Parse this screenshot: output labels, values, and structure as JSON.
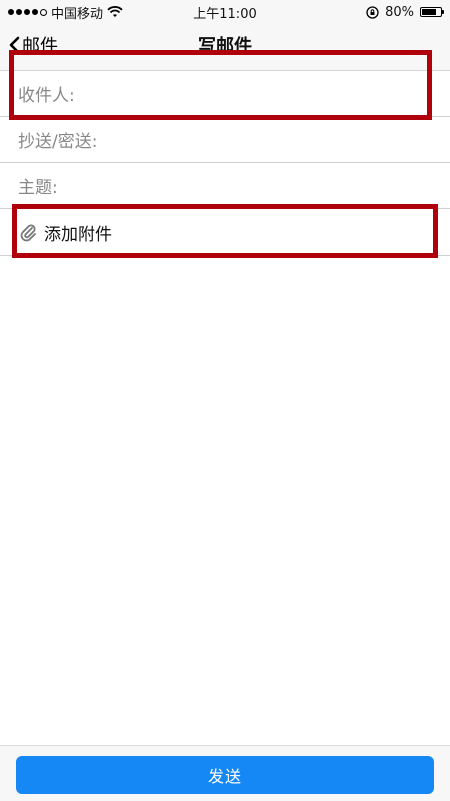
{
  "status_bar": {
    "carrier": "中国移动",
    "time": "上午11:00",
    "battery": "80%",
    "battery_level": 0.8
  },
  "nav": {
    "back_label": "邮件",
    "title": "写邮件"
  },
  "form": {
    "to_label": "收件人:",
    "cc_label": "抄送/密送:",
    "subject_label": "主题:",
    "attach_label": "添加附件"
  },
  "footer": {
    "send_label": "发送"
  },
  "colors": {
    "accent": "#1688f5",
    "highlight": "#b0000b"
  }
}
